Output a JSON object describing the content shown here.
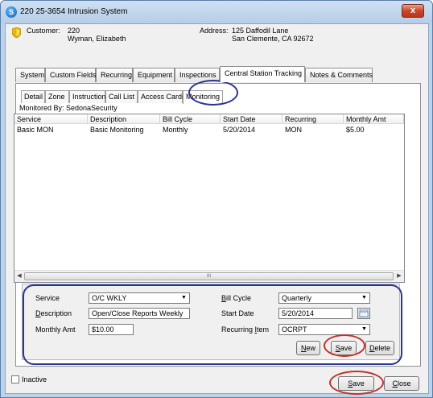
{
  "window": {
    "title": "220 25-3654 Intrusion System",
    "close_glyph": "x"
  },
  "customer": {
    "label": "Customer:",
    "number": "220",
    "name": "Wyman, Elizabeth",
    "address_label": "Address:",
    "address_line1": "125 Daffodil Lane",
    "address_line2": "San Clemente, CA  92672"
  },
  "tabs": [
    {
      "label": "System"
    },
    {
      "label": "Custom Fields"
    },
    {
      "label": "Recurring"
    },
    {
      "label": "Equipment"
    },
    {
      "label": "Inspections"
    },
    {
      "label": "Central Station Tracking"
    },
    {
      "label": "Notes & Comments"
    }
  ],
  "subtabs": [
    {
      "label": "Detail"
    },
    {
      "label": "Zone"
    },
    {
      "label": "Instruction"
    },
    {
      "label": "Call List"
    },
    {
      "label": "Access Cards"
    },
    {
      "label": "Monitoring"
    }
  ],
  "monitored_by": "Monitored By: SedonaSecurity",
  "grid": {
    "columns": [
      "Service",
      "Description",
      "Bill Cycle",
      "Start Date",
      "Recurring",
      "Monthly Amt"
    ],
    "rows": [
      [
        "Basic MON",
        "Basic Monitoring",
        "Monthly",
        "5/20/2014",
        "MON",
        "$5.00"
      ]
    ],
    "scroll_thumb_glyph": "III"
  },
  "form": {
    "service_label": "Service",
    "service_value": "O/C WKLY",
    "description_label_pre": "",
    "description_label_key": "D",
    "description_label_post": "escription",
    "description_value": "Open/Close Reports Weekly",
    "monthly_amt_label": "Monthly Amt",
    "monthly_amt_value": "$10.00",
    "bill_cycle_label_key": "B",
    "bill_cycle_label_post": "ill Cycle",
    "bill_cycle_value": "Quarterly",
    "start_date_label": "Start Date",
    "start_date_value": "5/20/2014",
    "recurring_item_label_pre": "Recurring ",
    "recurring_item_label_key": "I",
    "recurring_item_label_post": "tem",
    "recurring_item_value": "OCRPT",
    "new_key": "N",
    "new_post": "ew",
    "save_key": "S",
    "save_post": "ave",
    "delete_key": "D",
    "delete_post": "elete"
  },
  "footer": {
    "inactive_label": "Inactive",
    "save_key": "S",
    "save_post": "ave",
    "close_key": "C",
    "close_post": "lose"
  },
  "colors": {
    "highlight_red": "#c0322c",
    "highlight_blue": "#2a3592"
  }
}
